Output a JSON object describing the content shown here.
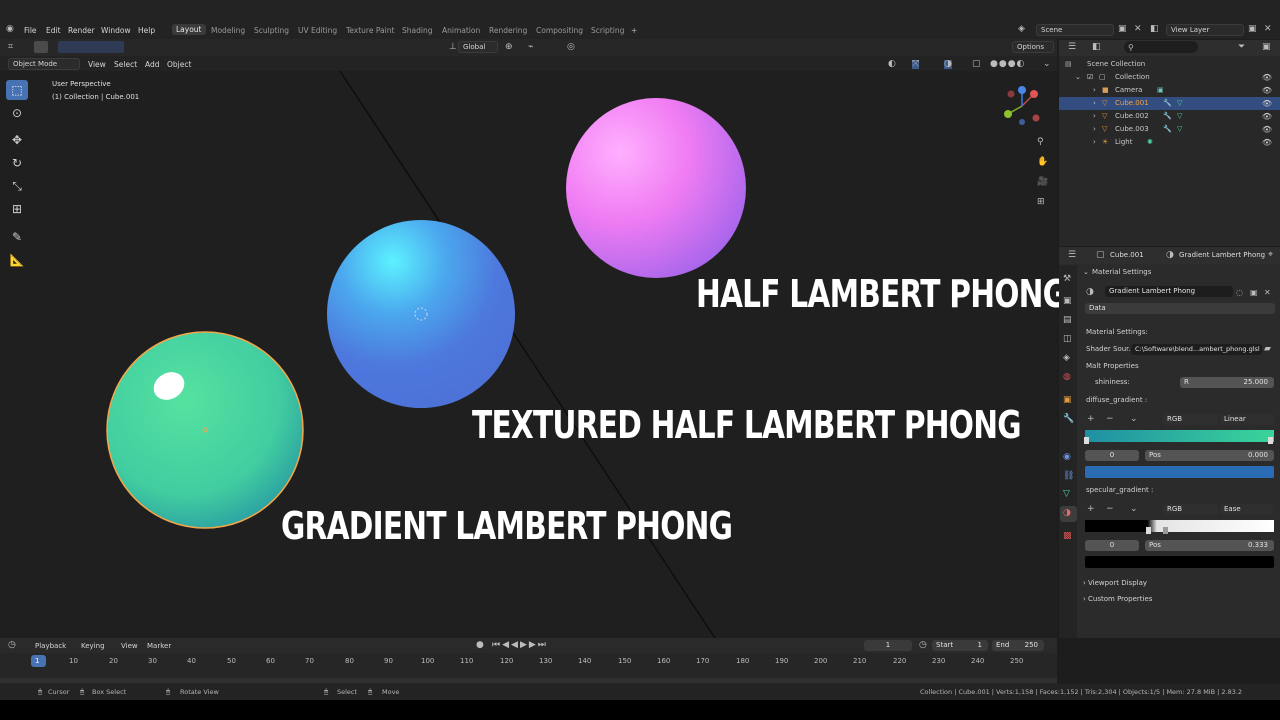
{
  "topbar": {
    "menus": [
      "File",
      "Edit",
      "Render",
      "Window",
      "Help"
    ],
    "workspaces": [
      "Layout",
      "Modeling",
      "Sculpting",
      "UV Editing",
      "Texture Paint",
      "Shading",
      "Animation",
      "Rendering",
      "Compositing",
      "Scripting"
    ],
    "active_workspace": "Layout",
    "add_tab": "+",
    "scene_label": "Scene",
    "view_layer_label": "View Layer"
  },
  "tool_header": {
    "transform_orientation": "Global",
    "options": "Options"
  },
  "viewport_header": {
    "mode": "Object Mode",
    "menus": [
      "View",
      "Select",
      "Add",
      "Object"
    ]
  },
  "viewport": {
    "overlay_title": "User Perspective",
    "overlay_subtitle": "(1) Collection | Cube.001",
    "labels": {
      "half_lambert": "HALF LAMBERT PHONG",
      "textured": "TEXTURED HALF LAMBERT PHONG",
      "gradient": "GRADIENT LAMBERT PHONG"
    },
    "colors": {
      "sphere_pink": "#e37cf5",
      "sphere_blue": "#4f7be0",
      "sphere_green": "#4fd7a0"
    }
  },
  "outliner": {
    "root": "Scene Collection",
    "collection": "Collection",
    "items": [
      {
        "name": "Camera",
        "selected": false
      },
      {
        "name": "Cube.001",
        "selected": true
      },
      {
        "name": "Cube.002",
        "selected": false
      },
      {
        "name": "Cube.003",
        "selected": false
      },
      {
        "name": "Light",
        "selected": false
      }
    ]
  },
  "properties": {
    "object_name": "Cube.001",
    "material_name": "Gradient Lambert Phong",
    "panel_title": "Material Settings",
    "material_field": "Gradient Lambert Phong",
    "data_dropdown": "Data",
    "material_settings_label": "Material Settings:",
    "shader_source_label": "Shader Sour...",
    "shader_source_value": "C:\\Software\\blend...ambert_phong.glsl",
    "malt_properties": "Malt Properties",
    "shininess_label": "shininess:",
    "shininess_channel": "R",
    "shininess_value": "25.000",
    "diffuse_gradient_label": "diffuse_gradient :",
    "diffuse_color_mode": "RGB",
    "diffuse_interp": "Linear",
    "diffuse_index": "0",
    "diffuse_pos_label": "Pos",
    "diffuse_pos_value": "0.000",
    "specular_gradient_label": "specular_gradient :",
    "specular_color_mode": "RGB",
    "specular_interp": "Ease",
    "specular_index": "0",
    "specular_pos_label": "Pos",
    "specular_pos_value": "0.333",
    "viewport_display": "Viewport Display",
    "custom_properties": "Custom Properties",
    "colors": {
      "diffuse_start": "#1f8fa3",
      "diffuse_end": "#3ad59a",
      "diffuse_stop": "#2a6db5"
    }
  },
  "timeline": {
    "menus": [
      "Playback",
      "Keying",
      "View",
      "Marker"
    ],
    "current_frame": "1",
    "start_label": "Start",
    "start_value": "1",
    "end_label": "End",
    "end_value": "250",
    "ticks": [
      "1",
      "10",
      "20",
      "30",
      "40",
      "50",
      "60",
      "70",
      "80",
      "90",
      "100",
      "110",
      "120",
      "130",
      "140",
      "150",
      "160",
      "170",
      "180",
      "190",
      "200",
      "210",
      "220",
      "230",
      "240",
      "250"
    ]
  },
  "statusbar": {
    "cursor": "Cursor",
    "box_select": "Box Select",
    "rotate_view": "Rotate View",
    "select": "Select",
    "move": "Move",
    "stats": "Collection | Cube.001 | Verts:1,158 | Faces:1,152 | Tris:2,304 | Objects:1/5 | Mem: 27.8 MiB | 2.83.2"
  }
}
